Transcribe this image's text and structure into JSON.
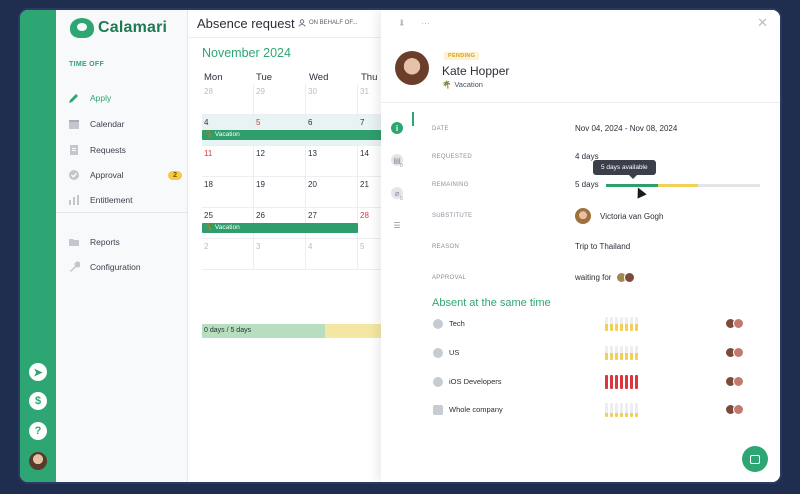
{
  "app": {
    "brand": "Calamari",
    "accent": "#2ea673"
  },
  "rail": {
    "icons": [
      "send-icon",
      "dollar-icon",
      "help-icon"
    ]
  },
  "sidebar": {
    "section_title": "TIME OFF",
    "items": [
      {
        "label": "Apply",
        "icon": "pen-icon",
        "active": true
      },
      {
        "label": "Calendar",
        "icon": "calendar-icon"
      },
      {
        "label": "Requests",
        "icon": "document-icon"
      },
      {
        "label": "Approval",
        "icon": "check-circle-icon",
        "badge": "2"
      },
      {
        "label": "Entitlement",
        "icon": "bar-chart-icon"
      },
      {
        "label": "Reports",
        "icon": "folder-icon"
      },
      {
        "label": "Configuration",
        "icon": "wrench-icon"
      }
    ]
  },
  "main": {
    "title": "Absence request",
    "on_behalf": "ON BEHALF OF...",
    "month": "November 2024",
    "weekdays": [
      "Mon",
      "Tue",
      "Wed",
      "Thu"
    ],
    "weeks": [
      [
        "28",
        "29",
        "30",
        "31"
      ],
      [
        "4",
        "5",
        "6",
        "7"
      ],
      [
        "11",
        "12",
        "13",
        "14"
      ],
      [
        "18",
        "19",
        "20",
        "21"
      ],
      [
        "25",
        "26",
        "27",
        "28"
      ],
      [
        "2",
        "3",
        "4",
        "5"
      ]
    ],
    "event_label": "Vacation",
    "summary": "0 days / 5 days"
  },
  "panel": {
    "status": "PENDING",
    "person": "Kate Hopper",
    "absence_type": "Vacation",
    "fields": {
      "date_label": "DATE",
      "date_value": "Nov 04, 2024 - Nov 08, 2024",
      "requested_label": "REQUESTED",
      "requested_value": "4 days",
      "remaining_label": "REMAINING",
      "remaining_value": "5 days",
      "substitute_label": "SUBSTITUTE",
      "substitute_value": "Victoria van Gogh",
      "reason_label": "REASON",
      "reason_value": "Trip to Thailand",
      "approval_label": "APPROVAL",
      "approval_value": "waiting for"
    },
    "tooltip": "5 days available",
    "remaining_bar": {
      "used_fraction": 0.34,
      "pending_fraction": 0.26
    },
    "badges": {
      "comments": "0",
      "attachments": "0"
    },
    "absent_title": "Absent at the same time",
    "teams": [
      {
        "name": "Tech",
        "color": "#f2cf57",
        "levels": [
          0.5,
          0.5,
          0.5,
          0.5,
          0.5,
          0.5,
          0.5
        ]
      },
      {
        "name": "US",
        "color": "#f2cf57",
        "levels": [
          0.5,
          0.5,
          0.5,
          0.5,
          0.5,
          0.5,
          0.5
        ]
      },
      {
        "name": "iOS Developers",
        "color": "#d9363e",
        "levels": [
          1,
          1,
          1,
          1,
          1,
          1,
          1
        ]
      },
      {
        "name": "Whole company",
        "color": "#f2cf57",
        "levels": [
          0.3,
          0.3,
          0.3,
          0.3,
          0.3,
          0.3,
          0.3
        ]
      }
    ]
  }
}
